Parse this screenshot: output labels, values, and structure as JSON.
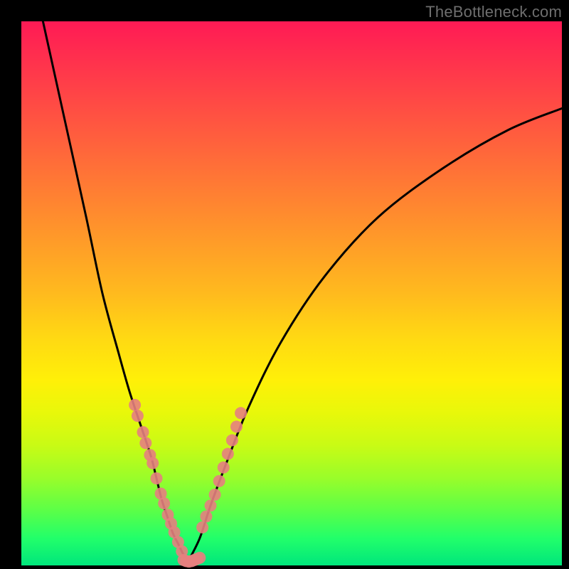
{
  "watermark": "TheBottleneck.com",
  "chart_data": {
    "type": "line",
    "title": "",
    "xlabel": "",
    "ylabel": "",
    "xlim": [
      0,
      100
    ],
    "ylim": [
      0,
      100
    ],
    "grid": false,
    "legend": false,
    "series": [
      {
        "name": "left-curve",
        "x": [
          4,
          8,
          12,
          15,
          18,
          20,
          22,
          24,
          25,
          26,
          27,
          28,
          29,
          30,
          31
        ],
        "values": [
          100,
          82,
          64,
          50,
          39,
          32,
          26,
          20,
          16,
          12,
          9,
          6,
          4,
          2,
          1
        ]
      },
      {
        "name": "right-curve",
        "x": [
          31,
          33,
          35,
          38,
          42,
          48,
          56,
          66,
          78,
          90,
          100
        ],
        "values": [
          1,
          5,
          11,
          19,
          29,
          41,
          53,
          64,
          73,
          80,
          84
        ]
      },
      {
        "name": "left-cluster-dots",
        "type": "scatter",
        "x": [
          21.0,
          21.5,
          22.5,
          23.0,
          23.8,
          24.3,
          25.0,
          25.8,
          26.4,
          27.1,
          27.7,
          28.3,
          29.0,
          29.7
        ],
        "values": [
          29.5,
          27.5,
          24.5,
          22.5,
          20.3,
          18.8,
          16.0,
          13.2,
          11.4,
          9.3,
          7.7,
          6.1,
          4.3,
          2.6
        ]
      },
      {
        "name": "right-cluster-dots",
        "type": "scatter",
        "x": [
          33.5,
          34.2,
          35.0,
          35.8,
          36.6,
          37.4,
          38.2,
          39.0,
          39.8,
          40.6
        ],
        "values": [
          7.0,
          9.0,
          11.0,
          13.0,
          15.5,
          18.0,
          20.5,
          23.0,
          25.5,
          28.0
        ]
      },
      {
        "name": "bottom-band-dots",
        "type": "scatter",
        "x": [
          30.0,
          30.5,
          31.0,
          31.5,
          32.0,
          32.5,
          33.0
        ],
        "values": [
          1.0,
          0.8,
          0.7,
          0.8,
          1.0,
          1.2,
          1.4
        ]
      }
    ],
    "gradient_stops": [
      {
        "pos": 0,
        "color": "#ff1a55"
      },
      {
        "pos": 50,
        "color": "#ffba1e"
      },
      {
        "pos": 72,
        "color": "#e8f80a"
      },
      {
        "pos": 100,
        "color": "#00e67c"
      }
    ]
  }
}
